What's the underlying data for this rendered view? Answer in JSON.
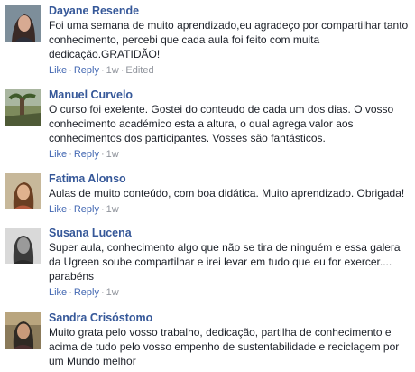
{
  "comments": [
    {
      "name": "Dayane Resende",
      "text": "Foi uma semana de muito aprendizado,eu agradeço por compartilhar tanto conhecimento, percebi que cada aula foi feito com muita dedicação.GRATIDÃO!",
      "like": "Like",
      "reply": "Reply",
      "time": "1w",
      "edited": "Edited",
      "avatar": "profile-photo"
    },
    {
      "name": "Manuel Curvelo",
      "text": "O curso foi exelente. Gostei do conteudo de cada um dos dias. O vosso conhecimento académico esta a altura, o qual agrega valor aos conhecimentos dos participantes. Vosses são fantásticos.",
      "like": "Like",
      "reply": "Reply",
      "time": "1w",
      "avatar": "profile-photo"
    },
    {
      "name": "Fatima Alonso",
      "text": "Aulas de muito conteúdo, com boa didática. Muito aprendizado. Obrigada!",
      "like": "Like",
      "reply": "Reply",
      "time": "1w",
      "avatar": "profile-photo"
    },
    {
      "name": "Susana Lucena",
      "text": "Super aula, conhecimento algo que não se tira de ninguém e essa galera da Ugreen soube compartilhar e irei levar em tudo que eu for exercer.... parabéns",
      "like": "Like",
      "reply": "Reply",
      "time": "1w",
      "avatar": "profile-photo"
    },
    {
      "name": "Sandra Crisóstomo",
      "text": "Muito grata pelo vosso trabalho, dedicação, partilha de conhecimento e acima de tudo pelo vosso empenho de sustentabilidade e reciclagem por um Mundo melhor",
      "avatar": "profile-photo"
    }
  ],
  "separator": "·",
  "colors": {
    "name": "#365899",
    "link": "#4267b2",
    "meta": "#90949c",
    "text": "#1d2129"
  }
}
